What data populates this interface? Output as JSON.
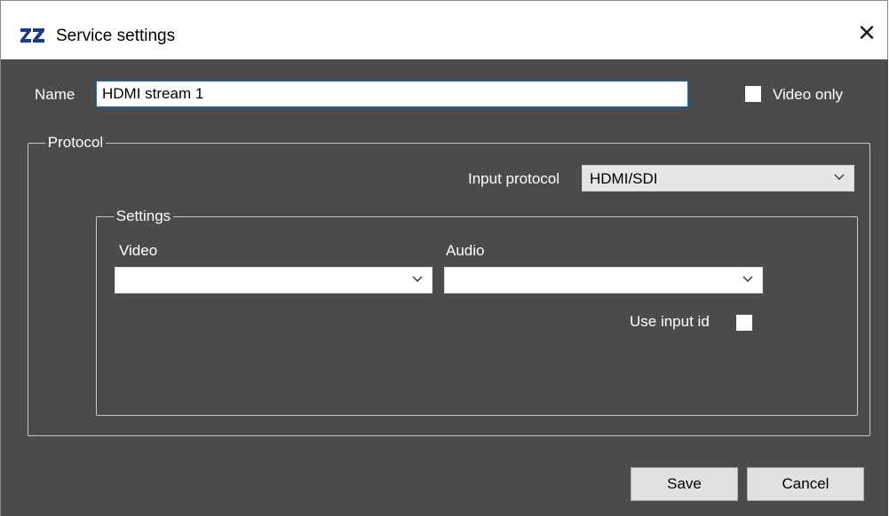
{
  "window": {
    "title": "Service settings",
    "close_symbol": "✕",
    "app_icon": "zz-logo-icon"
  },
  "form": {
    "name_label": "Name",
    "name_value": "HDMI stream 1",
    "video_only_label": "Video only",
    "video_only_checked": false
  },
  "protocol": {
    "legend": "Protocol",
    "input_protocol_label": "Input protocol",
    "input_protocol_value": "HDMI/SDI"
  },
  "settings": {
    "legend": "Settings",
    "video_label": "Video",
    "video_value": "",
    "audio_label": "Audio",
    "audio_value": "",
    "use_input_id_label": "Use input id",
    "use_input_id_checked": false
  },
  "buttons": {
    "save": "Save",
    "cancel": "Cancel"
  },
  "colors": {
    "client_background": "#4b4b4b",
    "focus_border": "#0078d7"
  }
}
